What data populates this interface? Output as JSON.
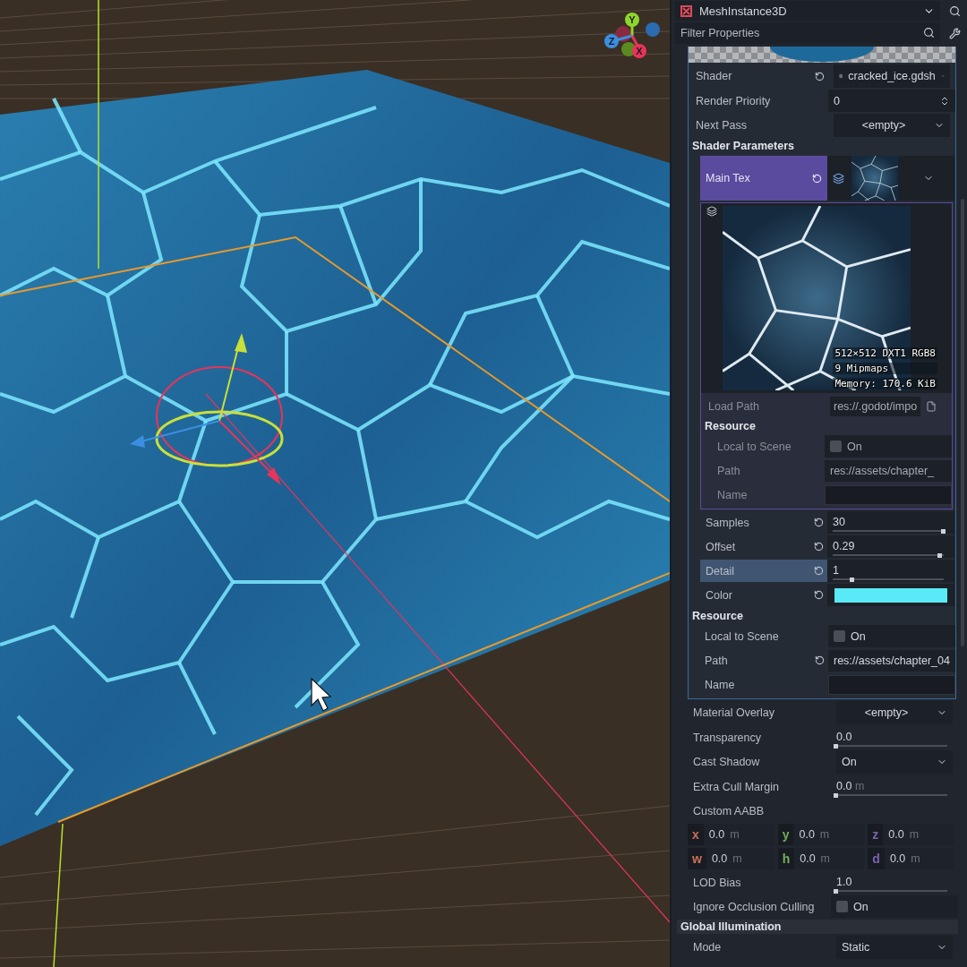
{
  "viewport": {
    "axis_gizmo": [
      {
        "label": "Y",
        "color": "#8fd62a"
      },
      {
        "label": "Z",
        "color": "#3b8fe0"
      },
      {
        "label": "X",
        "color": "#e8345a"
      }
    ]
  },
  "inspector": {
    "node_type": "MeshInstance3D",
    "filter": {
      "placeholder": "Filter Properties"
    },
    "material": {
      "rows": [
        {
          "kind": "resource",
          "label": "Shader",
          "value": "cracked_ice.gdsh",
          "revert": true
        },
        {
          "kind": "spin",
          "label": "Render Priority",
          "value": "0",
          "revert": false
        },
        {
          "kind": "dropdown",
          "label": "Next Pass",
          "value": "<empty>",
          "revert": false
        }
      ],
      "parameters": {
        "title": "Shader Parameters",
        "main_tex": {
          "label": "Main Tex",
          "selected": true,
          "revert": true,
          "info": [
            "512×512 DXT1 RGB8",
            "9 Mipmaps",
            "Memory: 170.6 KiB"
          ],
          "load_path": {
            "label": "Load Path",
            "value": "res://.godot/impo"
          },
          "resource": {
            "title": "Resource",
            "rows": [
              {
                "kind": "checkbox",
                "label": "Local to Scene",
                "value": "On",
                "checked": false,
                "revert": false
              },
              {
                "kind": "text",
                "label": "Path",
                "value": "res://assets/chapter_",
                "revert": false
              },
              {
                "kind": "text",
                "label": "Name",
                "revert": false
              }
            ]
          }
        },
        "rows": [
          {
            "kind": "slider",
            "label": "Samples",
            "value": "30",
            "level": 1,
            "revert": true,
            "selected": false
          },
          {
            "kind": "slider",
            "label": "Offset",
            "value": "0.29",
            "level": 0.97,
            "revert": true,
            "selected": false
          },
          {
            "kind": "slider",
            "label": "Detail",
            "value": "1",
            "level": 0.18,
            "revert": true,
            "selected": true
          },
          {
            "kind": "color",
            "label": "Color",
            "color": "#5ae9f7",
            "revert": true,
            "selected": false
          }
        ]
      },
      "resource": {
        "title": "Resource",
        "rows": [
          {
            "kind": "checkbox",
            "label": "Local to Scene",
            "value": "On",
            "checked": false,
            "revert": false
          },
          {
            "kind": "text",
            "label": "Path",
            "value": "res://assets/chapter_04",
            "revert": true
          },
          {
            "kind": "text",
            "label": "Name",
            "revert": false
          }
        ]
      }
    },
    "rows": [
      {
        "kind": "dropdown",
        "label": "Material Overlay",
        "value": "<empty>"
      },
      {
        "kind": "slider",
        "label": "Transparency",
        "value": "0.0",
        "level": 0
      },
      {
        "kind": "enum",
        "label": "Cast Shadow",
        "value": "On"
      },
      {
        "kind": "slider",
        "label": "Extra Cull Margin",
        "value": "0.0",
        "unit": "m",
        "level": 0
      },
      {
        "kind": "aabb",
        "label": "Custom AABB",
        "fields": [
          {
            "axis": "x",
            "value": "0.0",
            "unit": "m",
            "color": "#c8705a"
          },
          {
            "axis": "y",
            "value": "0.0",
            "unit": "m",
            "color": "#6fb15a"
          },
          {
            "axis": "z",
            "value": "0.0",
            "unit": "m",
            "color": "#7a62b0"
          },
          {
            "axis": "w",
            "value": "0.0",
            "unit": "m",
            "color": "#c8705a"
          },
          {
            "axis": "h",
            "value": "0.0",
            "unit": "m",
            "color": "#6fb15a"
          },
          {
            "axis": "d",
            "value": "0.0",
            "unit": "m",
            "color": "#7a62b0"
          }
        ]
      },
      {
        "kind": "slider",
        "label": "LOD Bias",
        "value": "1.0",
        "level": 0
      },
      {
        "kind": "checkbox",
        "label": "Ignore Occlusion Culling",
        "value": "On",
        "checked": false
      }
    ],
    "gi": {
      "title": "Global Illumination",
      "rows": [
        {
          "kind": "enum",
          "label": "Mode",
          "value": "Static"
        }
      ]
    }
  }
}
